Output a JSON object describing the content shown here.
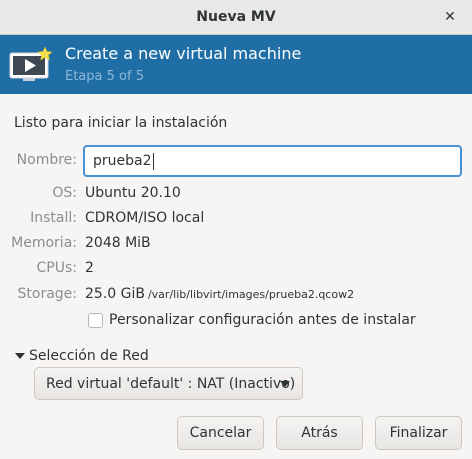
{
  "window": {
    "title": "Nueva MV",
    "close_glyph": "✕"
  },
  "header": {
    "title": "Create a new virtual machine",
    "subtitle": "Etapa 5 of 5",
    "icon": "monitor-play-icon",
    "bg_color": "#1f6fa6"
  },
  "summary": {
    "section_title": "Listo para iniciar la instalación",
    "name_label": "Nombre:",
    "name_value": "prueba2",
    "os_label": "OS:",
    "os_value": "Ubuntu 20.10",
    "install_label": "Install:",
    "install_value": "CDROM/ISO local",
    "memory_label": "Memoria:",
    "memory_value": "2048 MiB",
    "cpus_label": "CPUs:",
    "cpus_value": "2",
    "storage_label": "Storage:",
    "storage_value": "25.0 GiB",
    "storage_path": "/var/lib/libvirt/images/prueba2.qcow2",
    "customize_label": "Personalizar configuración antes de instalar",
    "customize_checked": false
  },
  "network": {
    "expander_label": "Selección de Red",
    "selected": "Red virtual 'default' : NAT (Inactivo)"
  },
  "buttons": {
    "cancel": "Cancelar",
    "back": "Atrás",
    "finish": "Finalizar"
  }
}
